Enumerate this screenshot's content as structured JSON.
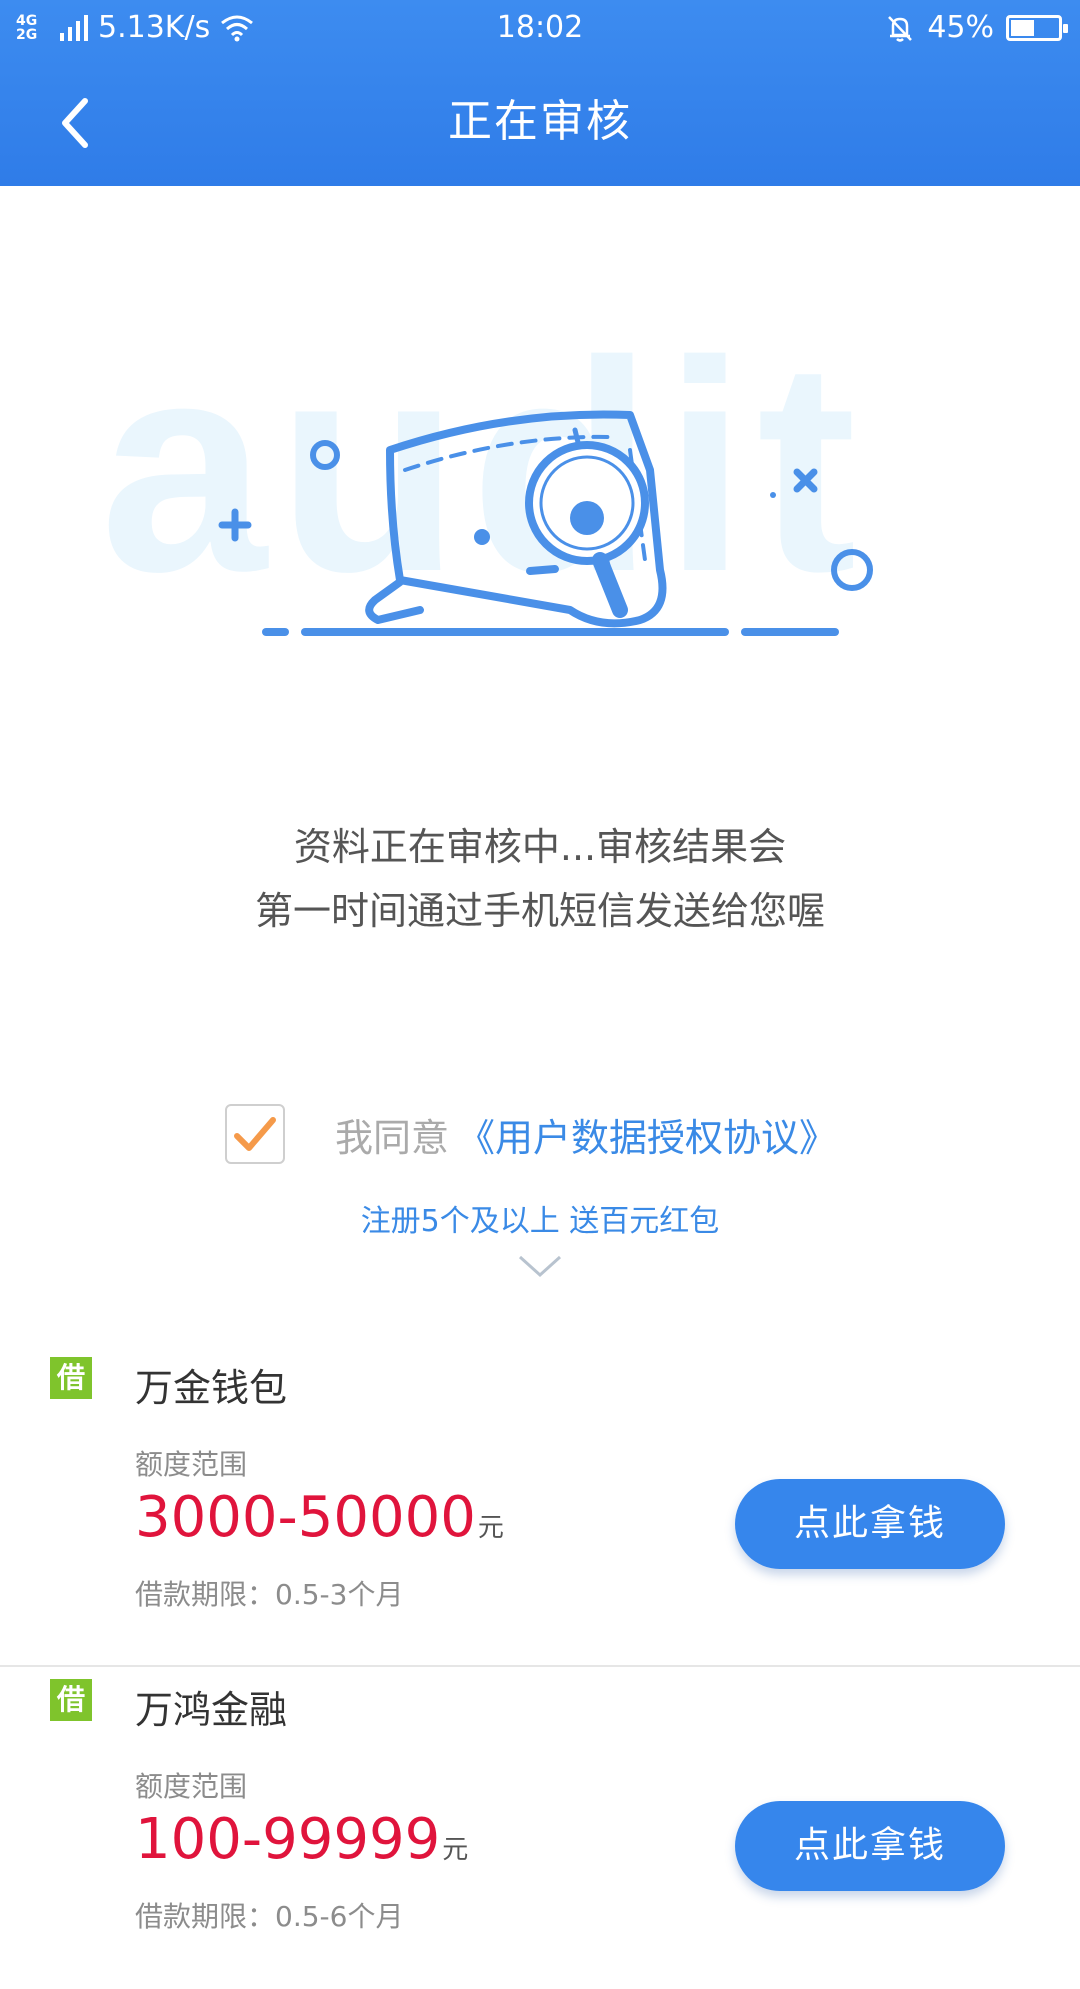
{
  "status_bar": {
    "network": "4G 2G",
    "speed": "5.13K/s",
    "time": "18:02",
    "battery": "45%"
  },
  "header": {
    "title": "正在审核"
  },
  "illustration": {
    "watermark": "audit"
  },
  "message": {
    "line1": "资料正在审核中...审核结果会",
    "line2": "第一时间通过手机短信发送给您喔"
  },
  "agreement": {
    "checked": true,
    "prefix": "我同意",
    "link": "《用户数据授权协议》"
  },
  "promo": {
    "text": "注册5个及以上 送百元红包"
  },
  "products": [
    {
      "badge": "借",
      "name": "万金钱包",
      "range_label": "额度范围",
      "amount": "3000-50000",
      "unit": "元",
      "term": "借款期限：0.5-3个月",
      "button": "点此拿钱"
    },
    {
      "badge": "借",
      "name": "万鸿金融",
      "range_label": "额度范围",
      "amount": "100-99999",
      "unit": "元",
      "term": "借款期限：0.5-6个月",
      "button": "点此拿钱"
    }
  ],
  "colors": {
    "primary": "#3686ec",
    "amount": "#e0143c",
    "badge": "#7fc42c",
    "check": "#f59a4a"
  }
}
